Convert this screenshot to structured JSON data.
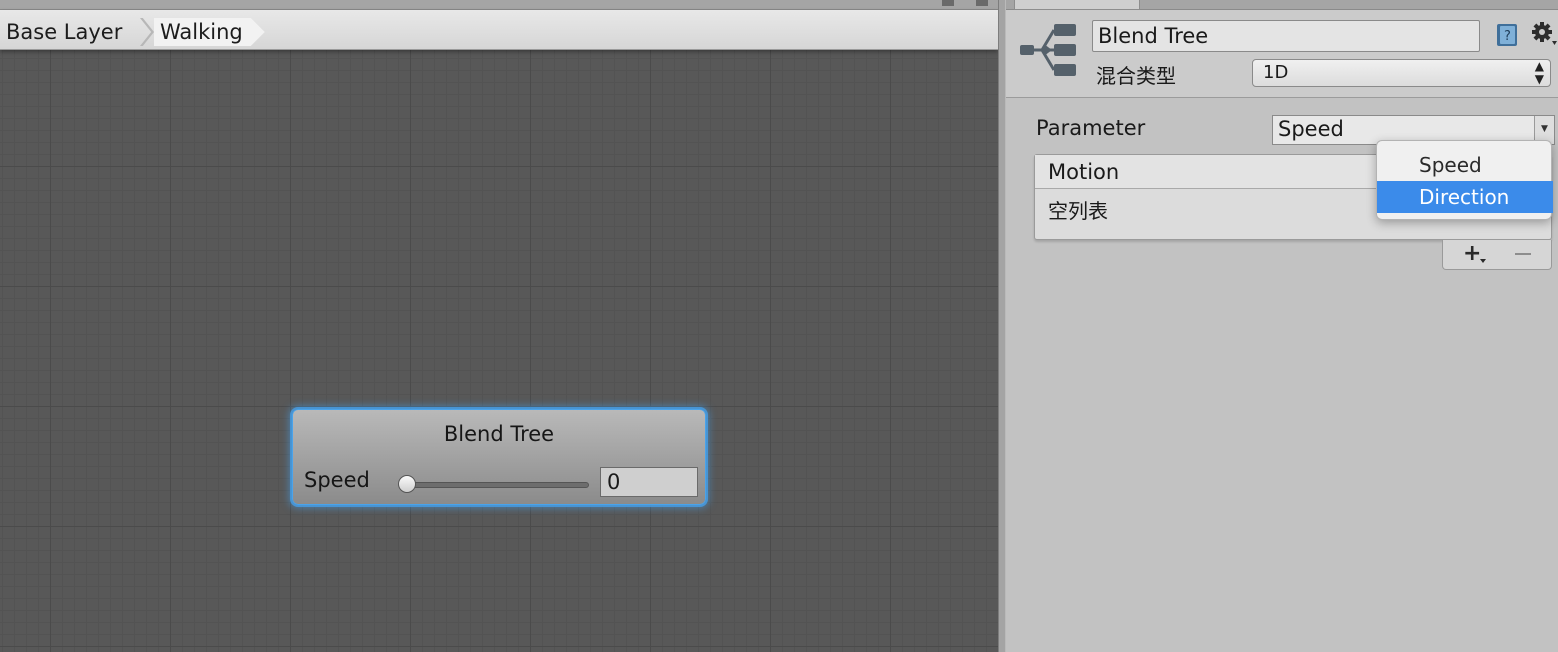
{
  "animator": {
    "breadcrumbs": [
      {
        "label": "Base Layer"
      },
      {
        "label": "Walking"
      }
    ],
    "node": {
      "title": "Blend Tree",
      "param_label": "Speed",
      "param_value": "0",
      "slider_fraction": 0
    }
  },
  "inspector": {
    "object_name": "Blend Tree",
    "blend_type_label": "混合类型",
    "blend_type_value": "1D",
    "parameter_label": "Parameter",
    "parameter_value": "Speed",
    "motion_list": {
      "header": "Motion",
      "empty_text": "空列表",
      "add_label": "+",
      "remove_label": "−"
    },
    "parameter_dropdown": {
      "options": [
        {
          "label": "Speed",
          "selected": false
        },
        {
          "label": "Direction",
          "selected": true
        }
      ]
    }
  },
  "icons": [
    "blend-tree-icon",
    "help-book-icon",
    "gear-icon",
    "select-arrows-icon",
    "dropdown-arrow-icon",
    "plus-icon",
    "minus-icon"
  ],
  "colors": {
    "selection_blue": "#3b8bea",
    "node_glow": "#4aa3ea",
    "grid_background": "#585858"
  }
}
